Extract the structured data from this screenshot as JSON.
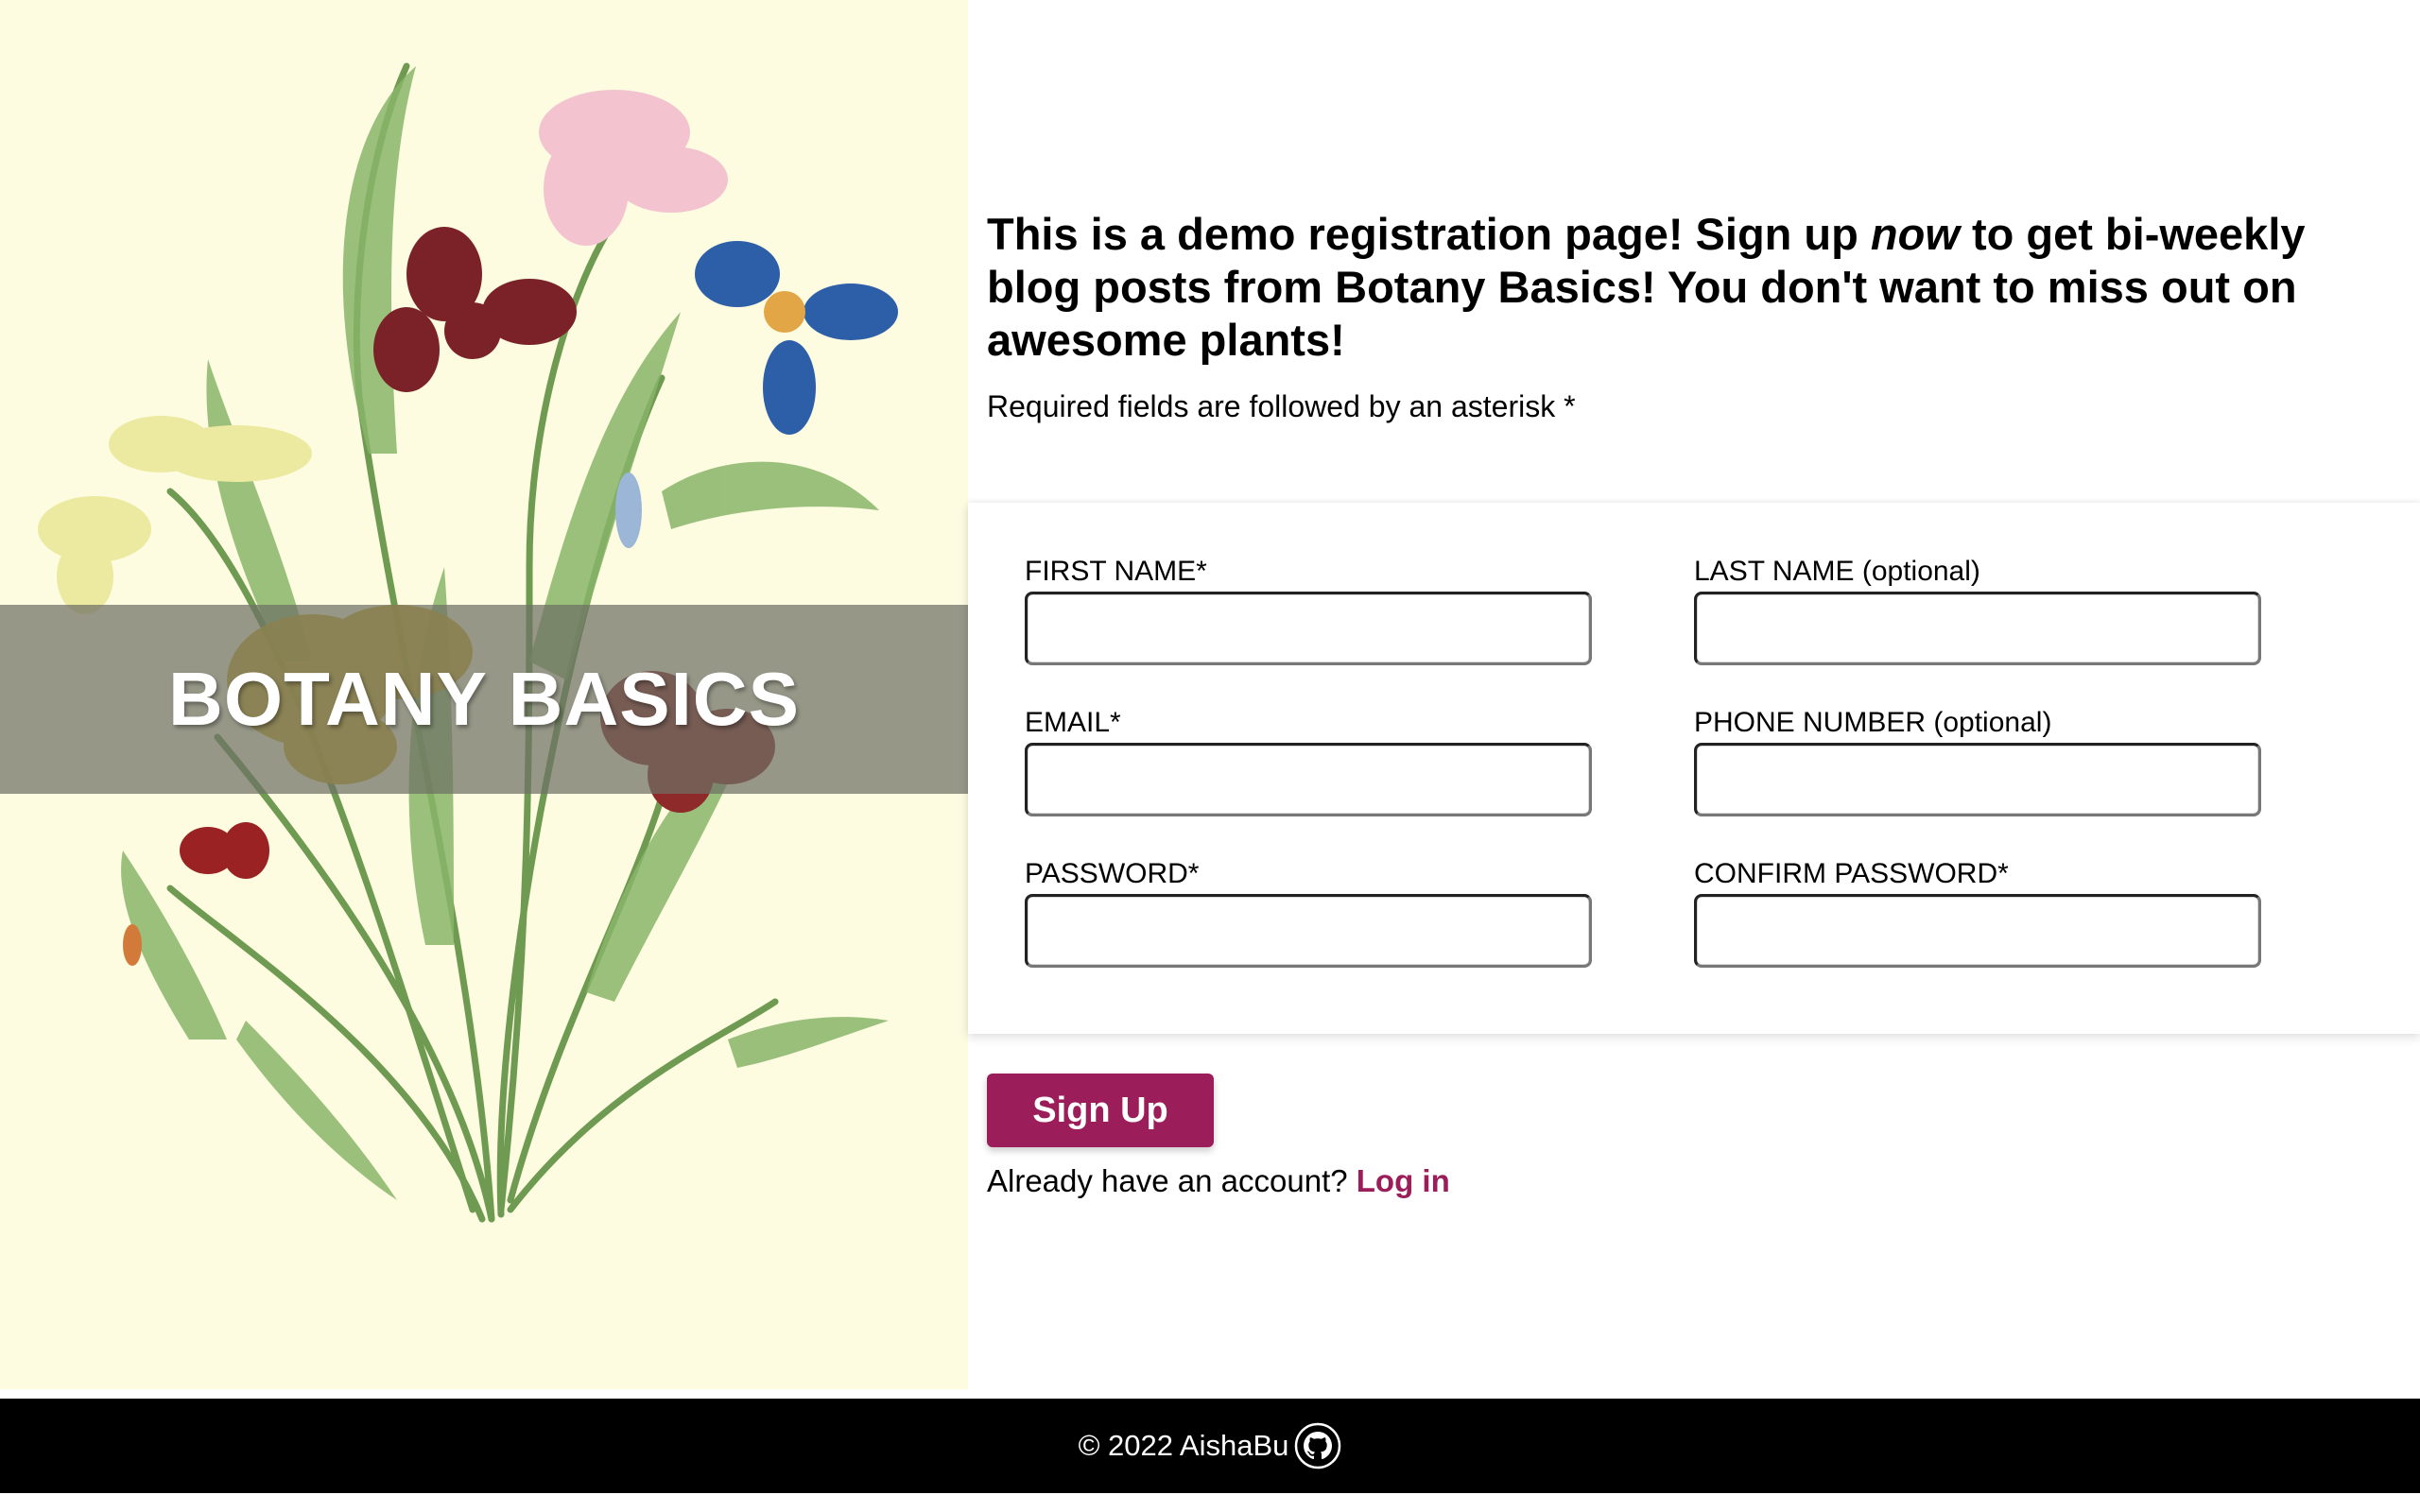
{
  "brand": {
    "title": "BOTANY BASICS"
  },
  "intro": {
    "heading_part1": "This is a demo registration page! Sign up ",
    "heading_emphasis": "now",
    "heading_part2": " to get bi-weekly blog posts from Botany Basics! You don't want to miss out on awesome plants!",
    "required_note": "Required fields are followed by an asterisk *"
  },
  "form": {
    "first_name_label": "FIRST NAME*",
    "first_name_value": "",
    "last_name_label": "LAST NAME (optional)",
    "last_name_value": "",
    "email_label": "EMAIL*",
    "email_value": "",
    "phone_label": "PHONE NUMBER (optional)",
    "phone_value": "",
    "password_label": "PASSWORD*",
    "password_value": "",
    "confirm_password_label": "CONFIRM PASSWORD*",
    "confirm_password_value": ""
  },
  "actions": {
    "signup_label": "Sign Up",
    "account_prompt": "Already have an account? ",
    "login_label": "Log in"
  },
  "footer": {
    "copyright": "© 2022 AishaBu",
    "icon": "github-icon"
  },
  "colors": {
    "accent": "#9b1d5a",
    "left_background": "#fdfbe0",
    "brand_band": "#6e7064",
    "footer_background": "#000000"
  }
}
